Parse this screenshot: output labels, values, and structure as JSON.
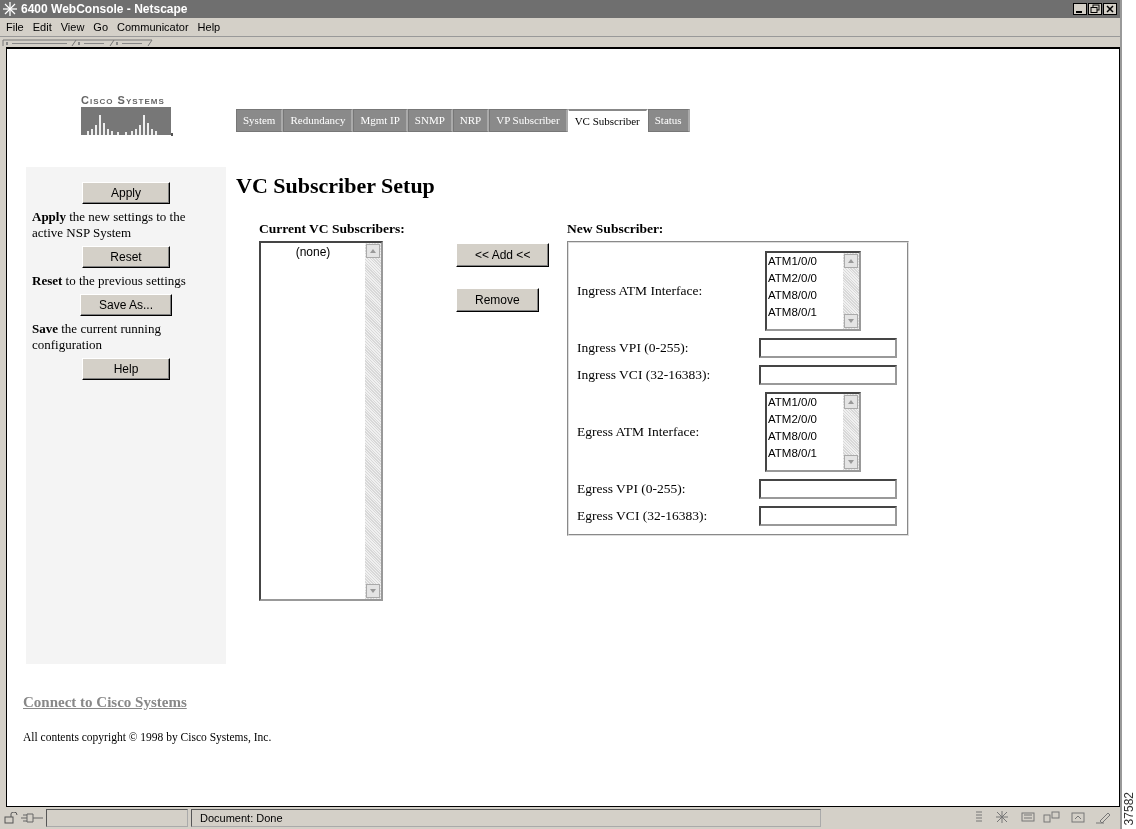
{
  "window": {
    "title": "6400 WebConsole - Netscape"
  },
  "menu": [
    {
      "label": "File"
    },
    {
      "label": "Edit"
    },
    {
      "label": "View"
    },
    {
      "label": "Go"
    },
    {
      "label": "Communicator"
    },
    {
      "label": "Help"
    }
  ],
  "logo": {
    "text": "Cisco Systems"
  },
  "tabs": [
    {
      "label": "System",
      "selected": false
    },
    {
      "label": "Redundancy",
      "selected": false
    },
    {
      "label": "Mgmt IP",
      "selected": false
    },
    {
      "label": "SNMP",
      "selected": false
    },
    {
      "label": "NRP",
      "selected": false
    },
    {
      "label": "VP Subscriber",
      "selected": false
    },
    {
      "label": "VC Subscriber",
      "selected": true
    },
    {
      "label": "Status",
      "selected": false
    }
  ],
  "sidebar": [
    {
      "button": "Apply",
      "description": "**Apply** the new settings to the active NSP System"
    },
    {
      "button": "Reset",
      "description": "**Reset** to the previous settings"
    },
    {
      "button": "Save As...",
      "description": "**Save** the current running configuration"
    },
    {
      "button": "Help"
    }
  ],
  "heading": "VC Subscriber Setup",
  "current": {
    "label": "Current VC Subscribers:",
    "items": [
      "(none)"
    ]
  },
  "actions": [
    "<< Add <<",
    "Remove"
  ],
  "new_subscriber": {
    "label": "New Subscriber:",
    "fields": [
      {
        "kind": "list",
        "label": "Ingress ATM Interface:",
        "options": [
          "ATM1/0/0",
          "ATM2/0/0",
          "ATM8/0/0",
          "ATM8/0/1"
        ]
      },
      {
        "kind": "text",
        "label": "Ingress VPI (0-255):"
      },
      {
        "kind": "text",
        "label": "Ingress VCI (32-16383):"
      },
      {
        "kind": "list",
        "label": "Egress ATM Interface:",
        "options": [
          "ATM1/0/0",
          "ATM2/0/0",
          "ATM8/0/0",
          "ATM8/0/1"
        ]
      },
      {
        "kind": "text",
        "label": "Egress VPI (0-255):"
      },
      {
        "kind": "text",
        "label": "Egress VCI (32-16383):"
      }
    ]
  },
  "footer": {
    "link": "Connect to Cisco Systems",
    "copyright": "All contents copyright © 1998 by Cisco Systems, Inc."
  },
  "status_bar": {
    "text": "Document: Done"
  },
  "figure_id": "37582"
}
